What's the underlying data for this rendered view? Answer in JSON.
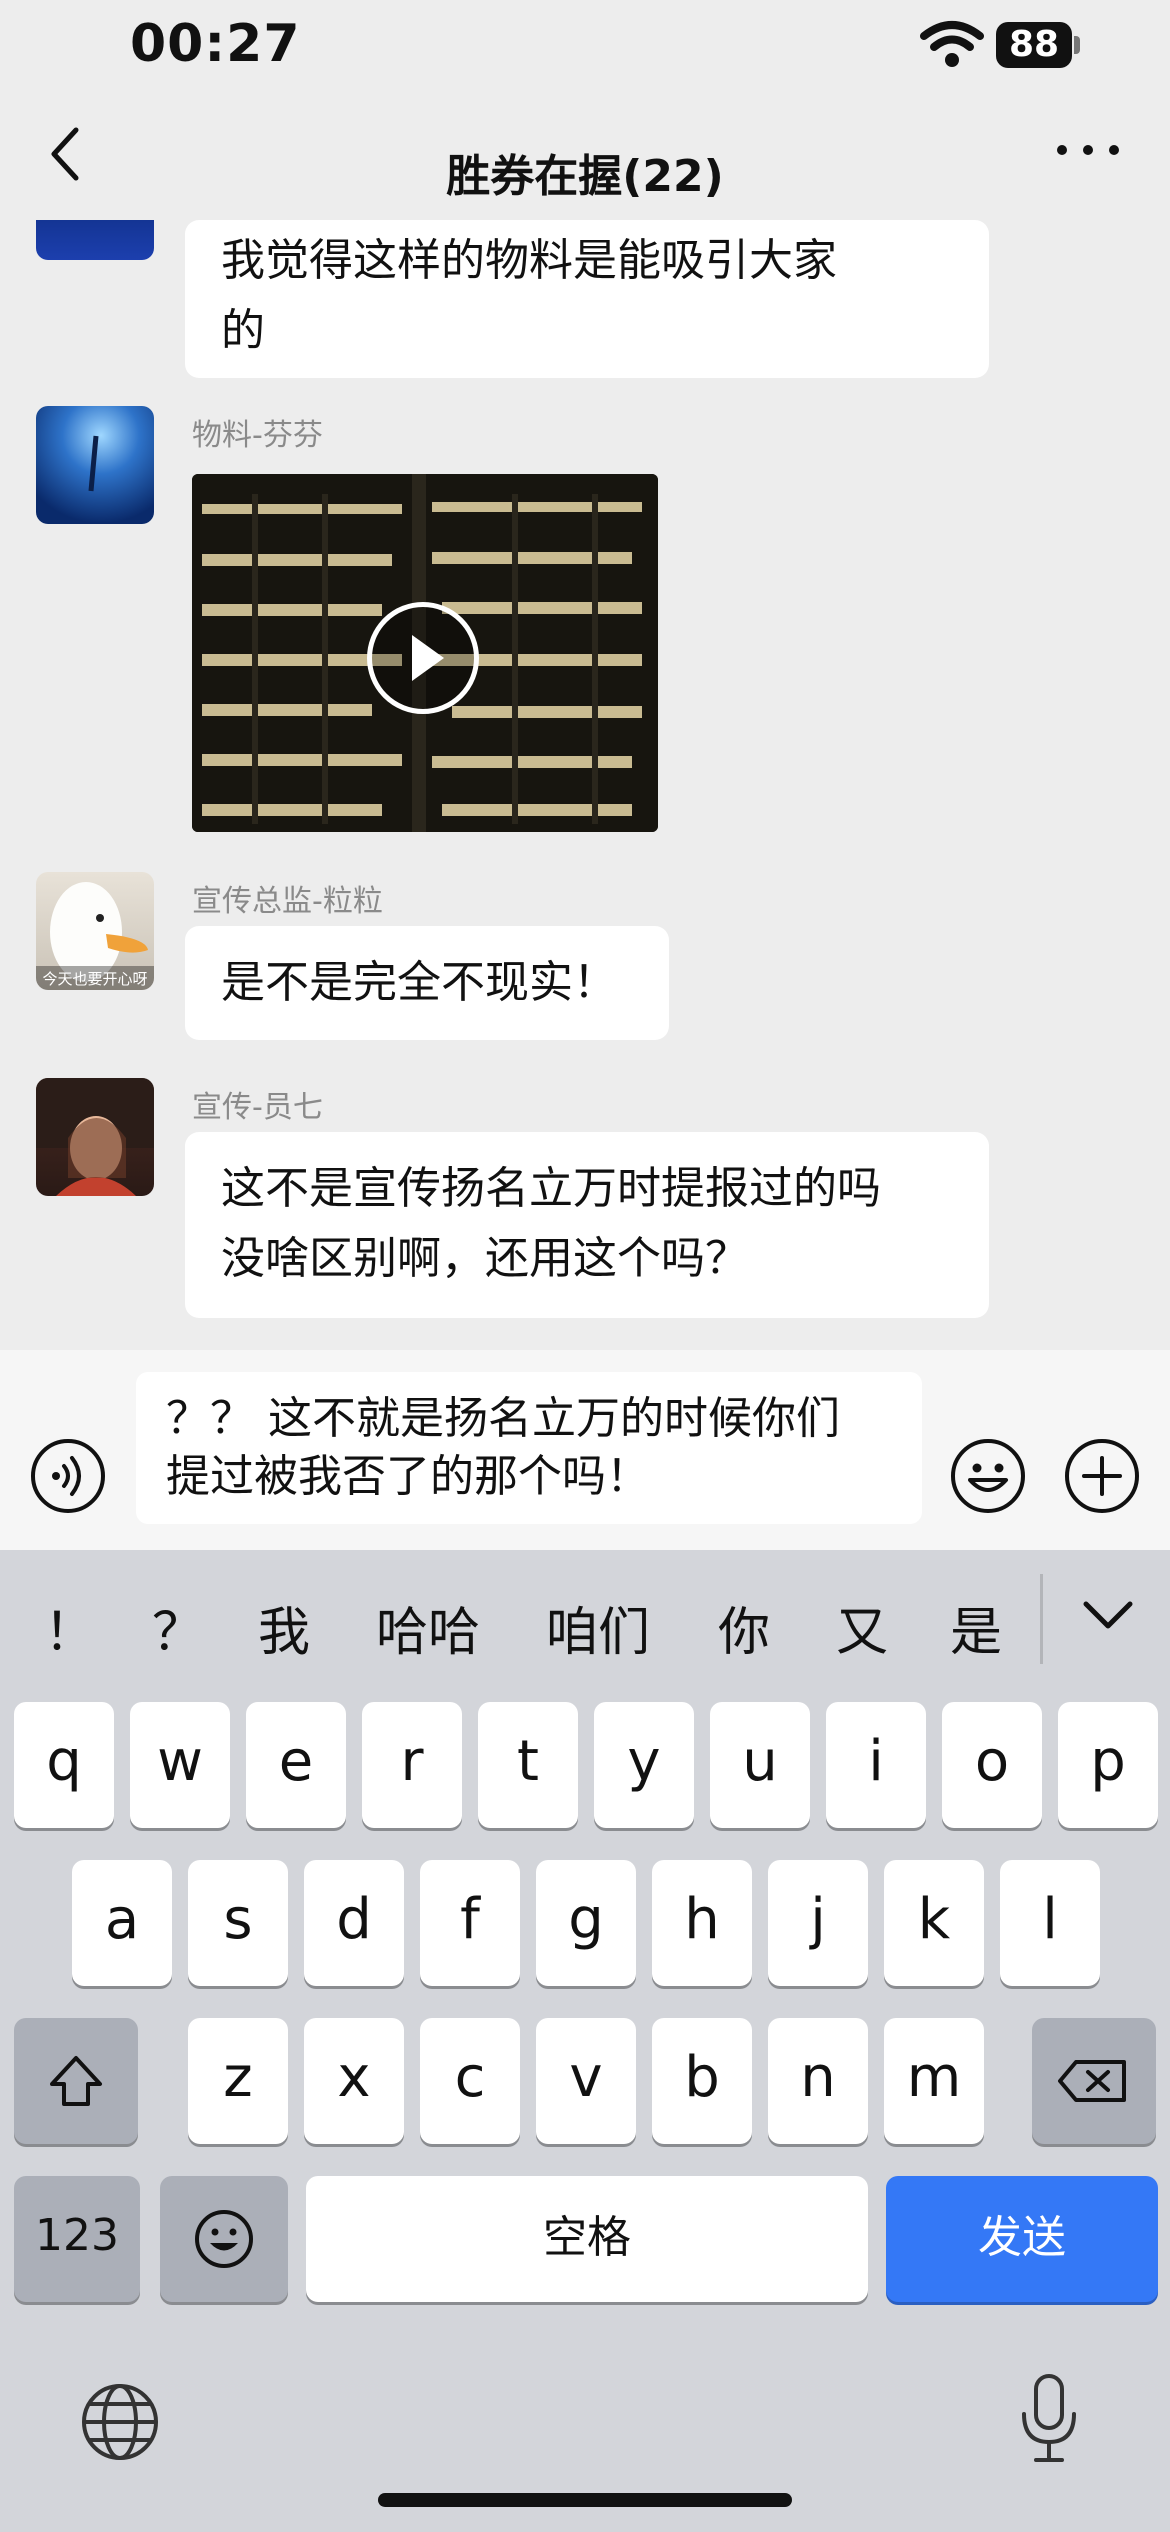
{
  "status_bar": {
    "time": "00:27",
    "battery": "88"
  },
  "nav": {
    "title": "胜券在握(22)"
  },
  "messages": [
    {
      "sender": "",
      "lines": [
        "我觉得这样的物料是能吸引大家",
        "的"
      ]
    },
    {
      "sender": "物料-芬芬",
      "type": "video"
    },
    {
      "sender": "宣传总监-粒粒",
      "lines": [
        "是不是完全不现实！"
      ],
      "avatar_caption": "今天也要开心呀"
    },
    {
      "sender": "宣传-员七",
      "lines": [
        "这不是宣传扬名立万时提报过的吗",
        "没啥区别啊，还用这个吗？"
      ]
    }
  ],
  "input": {
    "lines": [
      "？？ 这不就是扬名立万的时候你们",
      "提过被我否了的那个吗！"
    ]
  },
  "keyboard": {
    "suggestions": [
      "！",
      "？",
      "我",
      "哈哈",
      "咱们",
      "你",
      "又",
      "是"
    ],
    "row1": [
      "q",
      "w",
      "e",
      "r",
      "t",
      "y",
      "u",
      "i",
      "o",
      "p"
    ],
    "row2": [
      "a",
      "s",
      "d",
      "f",
      "g",
      "h",
      "j",
      "k",
      "l"
    ],
    "row3": [
      "z",
      "x",
      "c",
      "v",
      "b",
      "n",
      "m"
    ],
    "numbers_label": "123",
    "space_label": "空格",
    "send_label": "发送"
  },
  "colors": {
    "send": "#3478f6",
    "background": "#ededed",
    "keyboard": "#d3d5da"
  }
}
